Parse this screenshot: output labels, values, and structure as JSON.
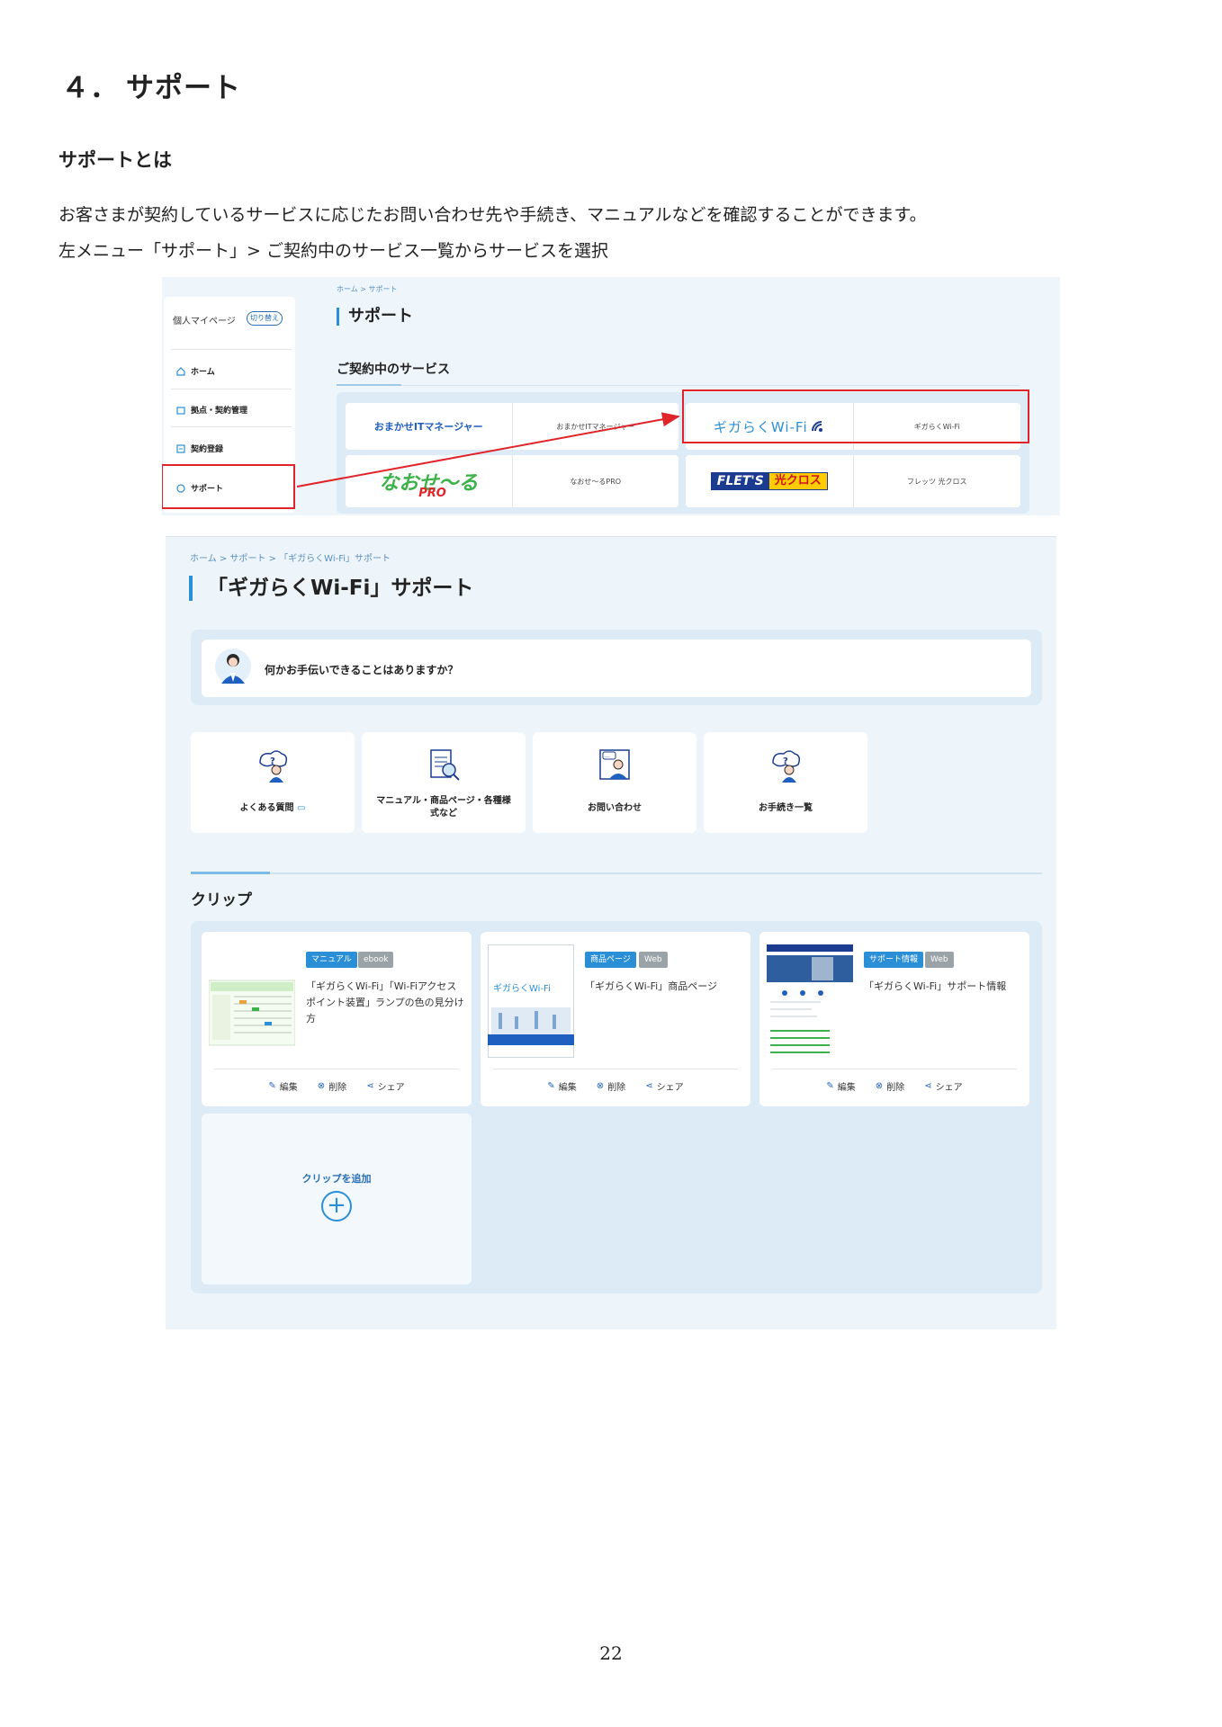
{
  "section": {
    "number": "４．",
    "title": "サポート"
  },
  "subsection": {
    "title": "サポートとは"
  },
  "paragraphs": [
    "お客さまが契約しているサービスに応じたお問い合わせ先や手続き、マニュアルなどを確認することができます。",
    "左メニュー「サポート」> ご契約中のサービス一覧からサービスを選択"
  ],
  "screenshot1": {
    "sidebar": {
      "profile_label": "個人マイページ",
      "switch_label": "切り替え",
      "items": [
        {
          "label": "ホーム",
          "icon": "home-icon"
        },
        {
          "label": "拠点・契約管理",
          "icon": "building-icon"
        },
        {
          "label": "契約登録",
          "icon": "register-icon"
        },
        {
          "label": "サポート",
          "icon": "support-icon"
        }
      ]
    },
    "breadcrumb": "ホーム > サポート",
    "heading": "サポート",
    "services_heading": "ご契約中のサービス",
    "services": [
      {
        "brand": "おまかせITマネージャー",
        "name": "おまかせITマネージャー"
      },
      {
        "brand": "ギガらくWi-Fi",
        "name": "ギガらくWi-Fi"
      },
      {
        "brand": "なおせ～る",
        "brand_sub": "PRO",
        "name": "なおせ～るPRO"
      },
      {
        "brand": "FLET'S",
        "brand_sub": "光クロス",
        "name": "フレッツ 光クロス"
      }
    ],
    "colors": {
      "highlight": "#e0242a",
      "accent": "#2a8fd6"
    }
  },
  "screenshot2": {
    "breadcrumb": "ホーム > サポート > 「ギガらくWi-Fi」サポート",
    "heading": "「ギガらくWi-Fi」サポート",
    "ask_text": "何かお手伝いできることはありますか？",
    "tiles": [
      {
        "label": "よくある質問",
        "icon": "faq-icon"
      },
      {
        "label_line1": "マニュアル・商品ページ・各種様",
        "label_line2": "式など",
        "icon": "manual-search-icon"
      },
      {
        "label": "お問い合わせ",
        "icon": "operator-icon"
      },
      {
        "label": "お手続き一覧",
        "icon": "procedure-icon"
      }
    ],
    "clip_heading": "クリップ",
    "clips": [
      {
        "tags": [
          "マニュアル",
          "ebook"
        ],
        "title": "「ギガらくWi-Fi」「Wi-Fiアクセスポイント装置」ランプの色の見分け方"
      },
      {
        "tags": [
          "商品ページ",
          "Web"
        ],
        "title": "「ギガらくWi-Fi」商品ページ"
      },
      {
        "tags": [
          "サポート情報",
          "Web"
        ],
        "title": "「ギガらくWi-Fi」サポート情報"
      }
    ],
    "actions": {
      "edit": "編集",
      "delete": "削除",
      "share": "シェア"
    },
    "add_clip_label": "クリップを追加"
  },
  "page_number": "22"
}
